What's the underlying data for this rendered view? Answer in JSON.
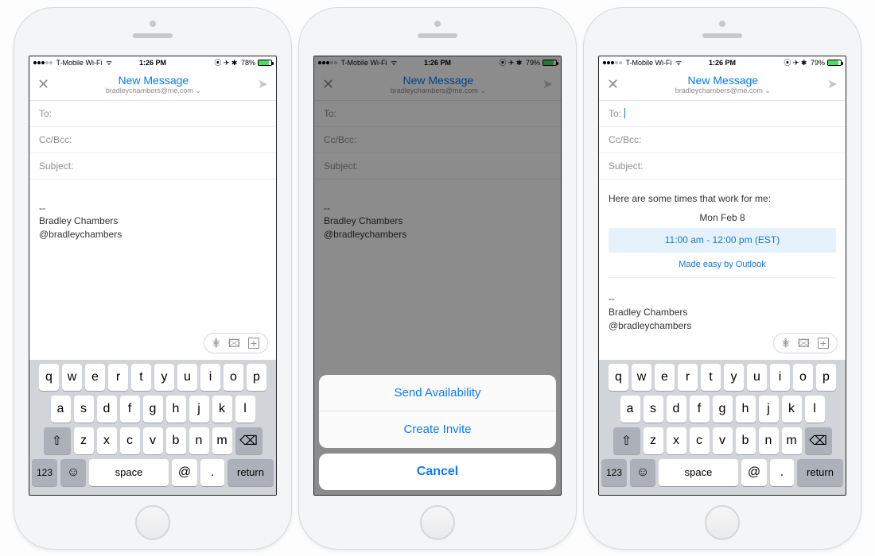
{
  "status": {
    "carrier": "T-Mobile Wi-Fi",
    "time": "1:26 PM",
    "battery1": "78%",
    "battery2": "79%",
    "battery3": "79%"
  },
  "nav": {
    "title": "New Message",
    "from": "bradleychambers@me.com"
  },
  "fields": {
    "to": "To:",
    "cc": "Cc/Bcc:",
    "subject": "Subject:"
  },
  "signature": {
    "dashes": "--",
    "name": "Bradley Chambers",
    "handle": "@bradleychambers"
  },
  "availability": {
    "intro": "Here are some times that work for me:",
    "day": "Mon Feb 8",
    "slot": "11:00 am - 12:00 pm (EST)",
    "made": "Made easy by Outlook"
  },
  "sheet": {
    "opt1": "Send Availability",
    "opt2": "Create Invite",
    "cancel": "Cancel"
  },
  "kbd": {
    "r1": [
      "q",
      "w",
      "e",
      "r",
      "t",
      "y",
      "u",
      "i",
      "o",
      "p"
    ],
    "r2": [
      "a",
      "s",
      "d",
      "f",
      "g",
      "h",
      "j",
      "k",
      "l"
    ],
    "r3": [
      "z",
      "x",
      "c",
      "v",
      "b",
      "n",
      "m"
    ],
    "shift": "⇧",
    "del": "⌫",
    "num": "123",
    "emoji": "☺",
    "space": "space",
    "at": "@",
    "dot": ".",
    "ret": "return"
  }
}
